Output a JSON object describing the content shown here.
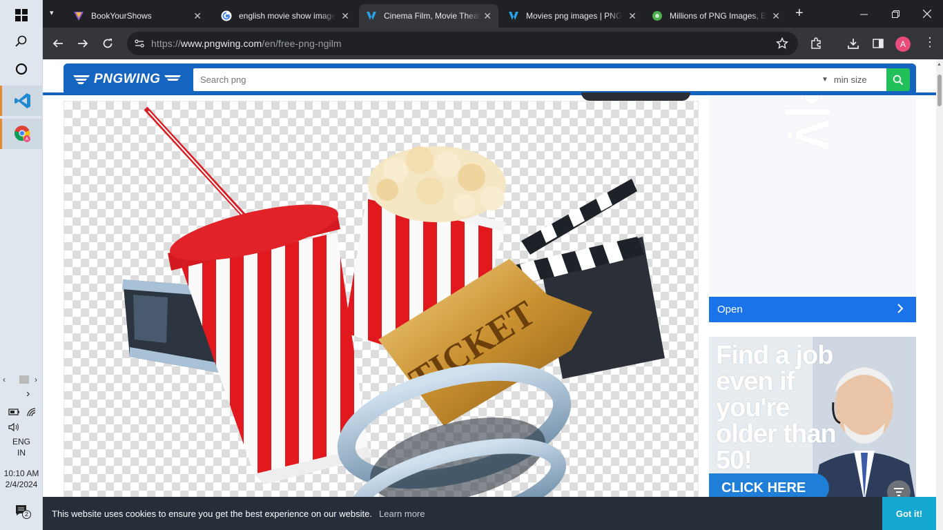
{
  "taskbar": {
    "start_icon": "windows-start-icon",
    "search_icon": "search-icon",
    "cortana_icon": "cortana-circle-icon",
    "vscode_icon": "vscode-icon",
    "chrome_icon": "chrome-icon",
    "tray": {
      "language_line1": "ENG",
      "language_line2": "IN",
      "time": "10:10 AM",
      "date": "2/4/2024",
      "notification_count": "2"
    }
  },
  "browser": {
    "tabs": [
      {
        "title": "BookYourShows",
        "favicon": "bookyourshows-icon"
      },
      {
        "title": "english movie show image",
        "favicon": "google-icon"
      },
      {
        "title": "Cinema Film, Movie Theater",
        "favicon": "pngwing-icon",
        "active": true
      },
      {
        "title": "Movies png images | PNGWing",
        "favicon": "pngwing-icon"
      },
      {
        "title": "Millions of PNG Images, Backgrounds",
        "favicon": "pngimages-icon"
      }
    ],
    "url_prefix": "https://",
    "url_host": "www.pngwing.com",
    "url_path": "/en/free-png-ngilm",
    "profile_initial": "A"
  },
  "site": {
    "logo_text": "PNGWING",
    "search_placeholder": "Search png",
    "min_size_label": "min size",
    "open_button_label": "Open",
    "ad": {
      "headline": "Find a job even if you're older than 50!",
      "cta": "CLICK HERE"
    },
    "cookie": {
      "message": "This website uses cookies to ensure you get the best experience on our website.",
      "learn_more": "Learn more",
      "accept": "Got it!"
    },
    "image_text": "TICKET"
  },
  "colors": {
    "brand_blue": "#1565c0",
    "search_green": "#21c05a",
    "open_blue": "#1a73e8",
    "cookie_bg": "#252e39",
    "cookie_button": "#14a7d0"
  }
}
